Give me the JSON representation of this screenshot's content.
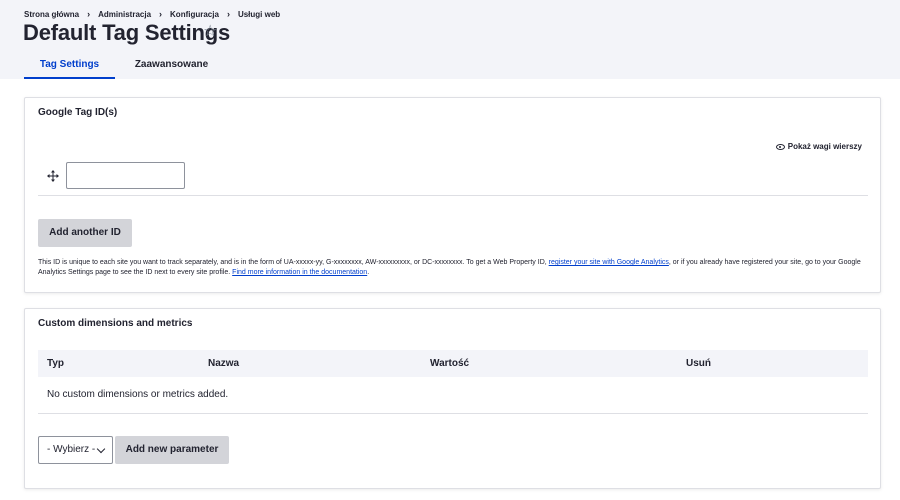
{
  "breadcrumb": {
    "items": [
      "Strona główna",
      "Administracja",
      "Konfiguracja",
      "Usługi web"
    ]
  },
  "page": {
    "title": "Default Tag Settings",
    "favorite_icon": "star-icon"
  },
  "tabs": [
    {
      "label": "Tag Settings",
      "active": true
    },
    {
      "label": "Zaawansowane",
      "active": false
    }
  ],
  "tag_ids_section": {
    "title": "Google Tag ID(s)",
    "show_weights_label": "Pokaż wagi wierszy",
    "id_value": "",
    "add_button_label": "Add another ID",
    "description_text": "This ID is unique to each site you want to track separately, and is in the form of UA-xxxxx-yy, G-xxxxxxxx, AW-xxxxxxxxx, or DC-xxxxxxxx. To get a Web Property ID, ",
    "description_link_1": "register your site with Google Analytics",
    "description_middle": ", or if you already have registered your site, go to your Google Analytics Settings page to see the ID next to every site profile. ",
    "description_link_2": "Find more information in the documentation",
    "description_end": "."
  },
  "custom_section": {
    "title": "Custom dimensions and metrics",
    "columns": [
      "Typ",
      "Nazwa",
      "Wartość",
      "Usuń"
    ],
    "empty_message": "No custom dimensions or metrics added.",
    "select_value": "- Wybierz -",
    "add_button_label": "Add new parameter"
  },
  "colors": {
    "accent": "#003ecc",
    "header_bg": "#f3f4f9",
    "button_bg": "#d3d4d9"
  }
}
